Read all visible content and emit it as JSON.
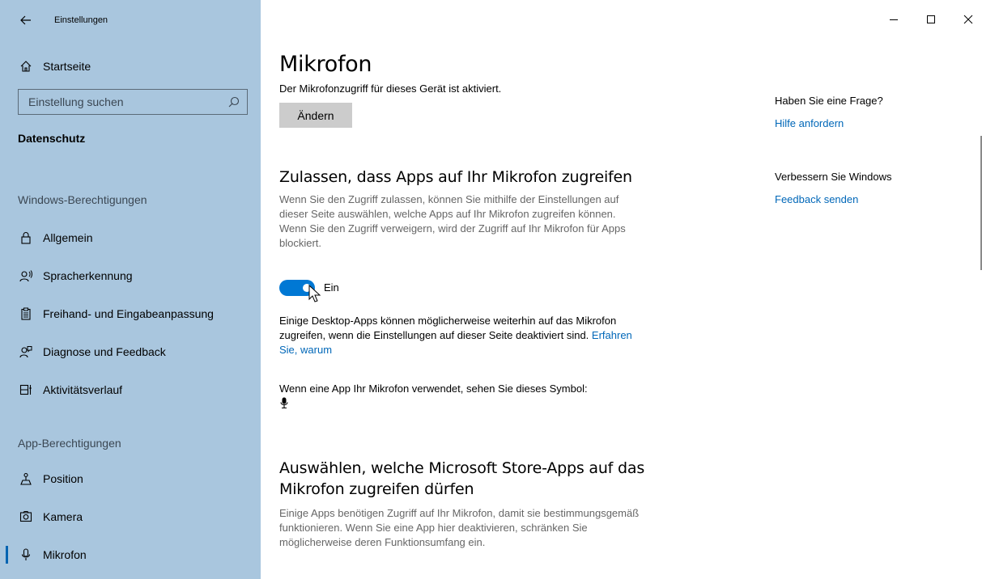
{
  "window": {
    "title": "Einstellungen",
    "controls": {
      "minimize": "–",
      "maximize": "☐",
      "close": "✕"
    }
  },
  "sidebar": {
    "home": {
      "label": "Startseite",
      "icon": "home-icon"
    },
    "search": {
      "placeholder": "Einstellung suchen",
      "icon": "search-icon"
    },
    "group_label": "Datenschutz",
    "windows_section": "Windows-Berechtigungen",
    "windows_items": [
      {
        "label": "Allgemein",
        "icon": "lock-icon"
      },
      {
        "label": "Spracherkennung",
        "icon": "speech-icon"
      },
      {
        "label": "Freihand- und Eingabeanpassung",
        "icon": "clipboard-icon"
      },
      {
        "label": "Diagnose und Feedback",
        "icon": "feedback-icon"
      },
      {
        "label": "Aktivitätsverlauf",
        "icon": "timeline-icon"
      }
    ],
    "app_section": "App-Berechtigungen",
    "app_items": [
      {
        "label": "Position",
        "icon": "location-icon"
      },
      {
        "label": "Kamera",
        "icon": "camera-icon"
      },
      {
        "label": "Mikrofon",
        "icon": "microphone-icon",
        "active": true
      }
    ]
  },
  "main": {
    "title": "Mikrofon",
    "status": "Der Mikrofonzugriff für dieses Gerät ist aktiviert.",
    "change_button": "Ändern",
    "allow_section": {
      "heading": "Zulassen, dass Apps auf Ihr Mikrofon zugreifen",
      "description": "Wenn Sie den Zugriff zulassen, können Sie mithilfe der Einstellungen auf dieser Seite auswählen, welche Apps auf Ihr Mikrofon zugreifen können. Wenn Sie den Zugriff verweigern, wird der Zugriff auf Ihr Mikrofon für Apps blockiert.",
      "toggle_label": "Ein",
      "toggle_on": true
    },
    "desktop_note": "Einige Desktop-Apps können möglicherweise weiterhin auf das Mikrofon zugreifen, wenn die Einstellungen auf dieser Seite deaktiviert sind.",
    "desktop_link": "Erfahren Sie, warum",
    "symbol_note": "Wenn eine App Ihr Mikrofon verwendet, sehen Sie dieses Symbol:",
    "store_section": {
      "heading_line1": "Auswählen, welche Microsoft Store-Apps auf das",
      "heading_line2": "Mikrofon zugreifen dürfen",
      "description": "Einige Apps benötigen Zugriff auf Ihr Mikrofon, damit sie bestimmungsgemäß funktionieren. Wenn Sie eine App hier deaktivieren, schränken Sie möglicherweise deren Funktionsumfang ein."
    }
  },
  "right_pane": {
    "question_heading": "Haben Sie eine Frage?",
    "help_link": "Hilfe anfordern",
    "improve_heading": "Verbessern Sie Windows",
    "feedback_link": "Feedback senden"
  },
  "colors": {
    "sidebar_bg": "#a9c6de",
    "accent": "#0078d4",
    "link": "#0067b8"
  }
}
